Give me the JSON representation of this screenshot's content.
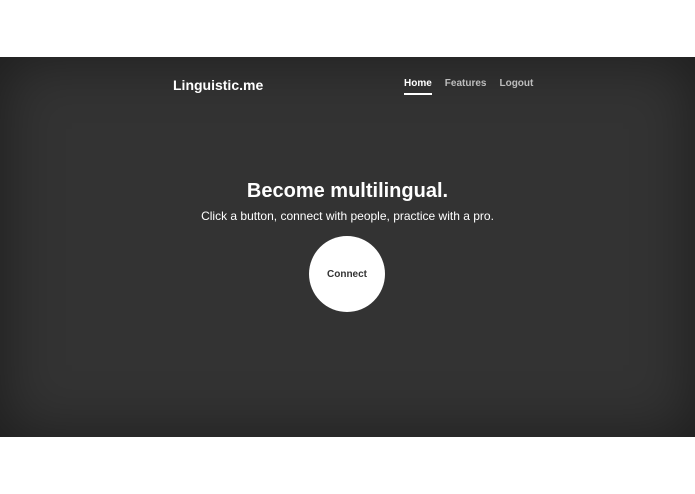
{
  "brand": "Linguistic.me",
  "nav": {
    "items": [
      "Home",
      "Features",
      "Logout"
    ],
    "active": "Home"
  },
  "hero": {
    "headline": "Become multilingual.",
    "subline": "Click a button, connect with people, practice with a pro.",
    "cta_label": "Connect"
  },
  "colors": {
    "background": "#333333",
    "text": "#ffffff",
    "nav_inactive": "#bdbdbd",
    "button_bg": "#ffffff",
    "button_text": "#333333"
  }
}
